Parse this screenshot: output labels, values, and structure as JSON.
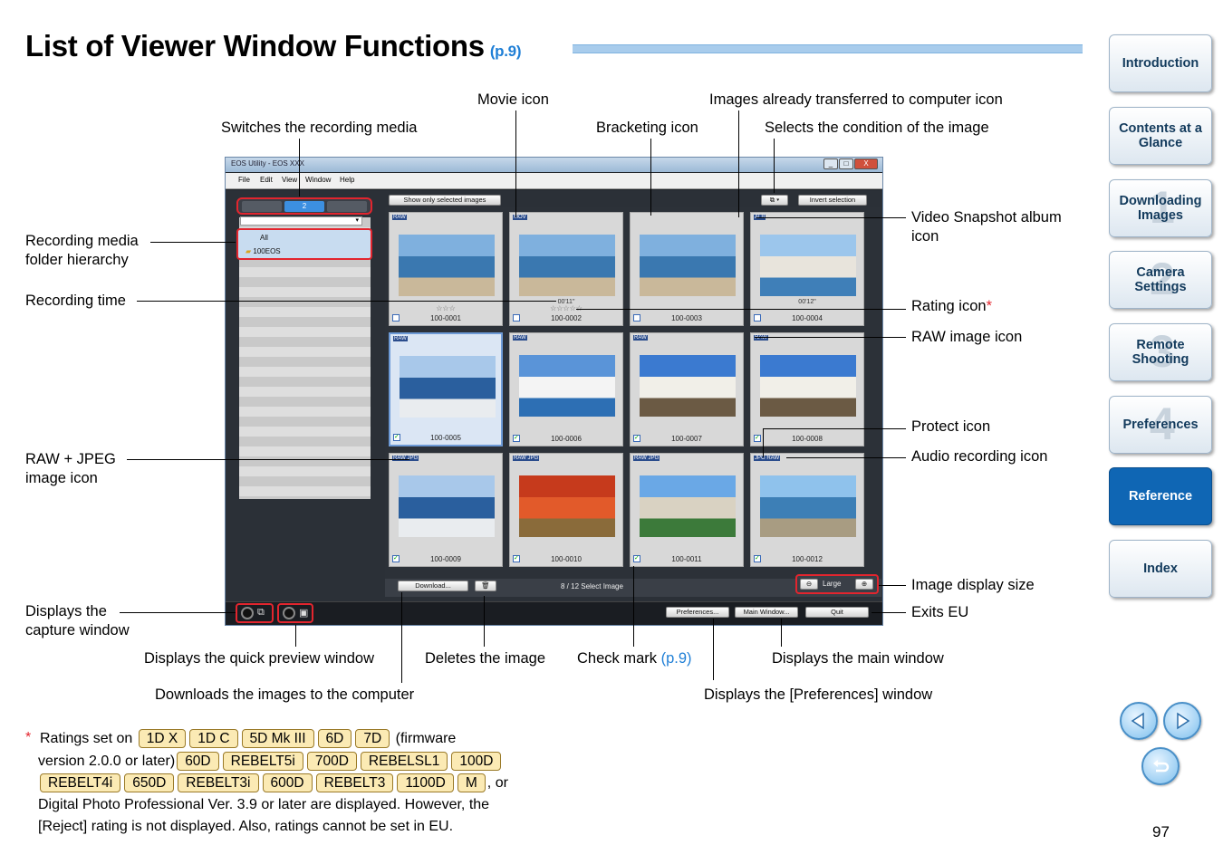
{
  "page": {
    "title": "List of Viewer Window Functions",
    "title_ref": "(p.9)",
    "page_number": "97"
  },
  "nav": {
    "items": [
      {
        "label": "Introduction",
        "num": ""
      },
      {
        "label": "Contents at a Glance",
        "num": ""
      },
      {
        "label": "Downloading Images",
        "num": "1"
      },
      {
        "label": "Camera Settings",
        "num": "2"
      },
      {
        "label": "Remote Shooting",
        "num": "3"
      },
      {
        "label": "Preferences",
        "num": "4"
      },
      {
        "label": "Reference",
        "num": ""
      },
      {
        "label": "Index",
        "num": ""
      }
    ],
    "active": "Reference",
    "colors": {
      "active": "#0f66b4",
      "inactive_text": "#123a5c"
    },
    "buttons": {
      "prev": "previous-page-icon",
      "next": "next-page-icon",
      "back": "return-icon"
    }
  },
  "callouts": {
    "movie_icon": "Movie icon",
    "transferred_icon": "Images already transferred to computer icon",
    "switch_media": "Switches the recording media",
    "bracketing_icon": "Bracketing icon",
    "selects_condition": "Selects the condition of the image",
    "video_snapshot_1": "Video Snapshot album",
    "video_snapshot_2": "icon",
    "rec_folder_1": "Recording media",
    "rec_folder_2": "folder hierarchy",
    "recording_time": "Recording time",
    "rating_icon": "Rating icon",
    "rating_star": "*",
    "raw_icon": "RAW image icon",
    "protect_icon": "Protect icon",
    "audio_icon": "Audio recording icon",
    "raw_jpeg_1": "RAW + JPEG",
    "raw_jpeg_2": "image icon",
    "image_size": "Image display size",
    "exits_eu": "Exits EU",
    "capture_1": "Displays the",
    "capture_2": "capture window",
    "quick_preview": "Displays the quick preview window",
    "deletes": "Deletes the image",
    "check_mark": "Check mark",
    "check_mark_ref": "(p.9)",
    "main_window": "Displays the main window",
    "downloads": "Downloads the images to the computer",
    "preferences_window": "Displays the [Preferences] window"
  },
  "window": {
    "title": "EOS Utility - EOS XXX",
    "menu": [
      "File",
      "Edit",
      "View",
      "Window",
      "Help"
    ],
    "controls": [
      "_",
      "□",
      "X"
    ],
    "media_tabs": [
      "",
      "2",
      ""
    ],
    "folders": [
      "All",
      "100EOS"
    ],
    "show_selected": "Show only selected images",
    "invert_selection": "Invert selection",
    "download": "Download...",
    "status": "8 / 12  Select Image",
    "size_label": "Large",
    "preferences": "Preferences...",
    "main_window": "Main Window...",
    "quit": "Quit",
    "thumbs": [
      {
        "name": "100-0001",
        "badge": "RAW",
        "stars": "☆☆☆",
        "time": "",
        "checked": false,
        "scene": "harbor"
      },
      {
        "name": "100-0002",
        "badge": "MOV",
        "stars": "☆☆☆☆☆",
        "time": "00'11\"",
        "checked": false,
        "scene": "harbor"
      },
      {
        "name": "100-0003",
        "badge": "",
        "stars": "",
        "time": "",
        "checked": false,
        "scene": "harbor"
      },
      {
        "name": "100-0004",
        "badge": "ALB",
        "stars": "",
        "time": "00'12\"",
        "checked": false,
        "scene": "town"
      },
      {
        "name": "100-0005",
        "badge": "RAW",
        "stars": "",
        "time": "",
        "checked": true,
        "scene": "cliff"
      },
      {
        "name": "100-0006",
        "badge": "RAW",
        "stars": "",
        "time": "",
        "checked": true,
        "scene": "church"
      },
      {
        "name": "100-0007",
        "badge": "RAW",
        "stars": "",
        "time": "",
        "checked": true,
        "scene": "windmill"
      },
      {
        "name": "100-0008",
        "badge": "RAW",
        "stars": "",
        "time": "",
        "checked": true,
        "scene": "windmill"
      },
      {
        "name": "100-0009",
        "badge": "RAW JPG",
        "stars": "",
        "time": "",
        "checked": true,
        "scene": "cliff"
      },
      {
        "name": "100-0010",
        "badge": "RAW JPG",
        "stars": "",
        "time": "",
        "checked": true,
        "scene": "tomato"
      },
      {
        "name": "100-0011",
        "badge": "RAW JPG",
        "stars": "",
        "time": "",
        "checked": true,
        "scene": "village"
      },
      {
        "name": "100-0012",
        "badge": "JPG RAW",
        "stars": "",
        "time": "",
        "checked": true,
        "scene": "sea"
      }
    ]
  },
  "footnote": {
    "star": "*",
    "intro": "Ratings set on",
    "badges1": [
      "1D X",
      "1D C",
      "5D Mk III",
      "6D",
      "7D"
    ],
    "firmware": "(firmware",
    "version": "version 2.0.0 or later)",
    "badges2": [
      "60D",
      "REBELT5i",
      "700D",
      "REBELSL1",
      "100D"
    ],
    "badges3": [
      "REBELT4i",
      "650D",
      "REBELT3i",
      "600D",
      "REBELT3",
      "1100D",
      "M"
    ],
    "or": ", or",
    "line4": "Digital Photo Professional Ver. 3.9 or later are displayed. However, the",
    "line5": "[Reject] rating is not displayed. Also, ratings cannot be set in EU."
  }
}
